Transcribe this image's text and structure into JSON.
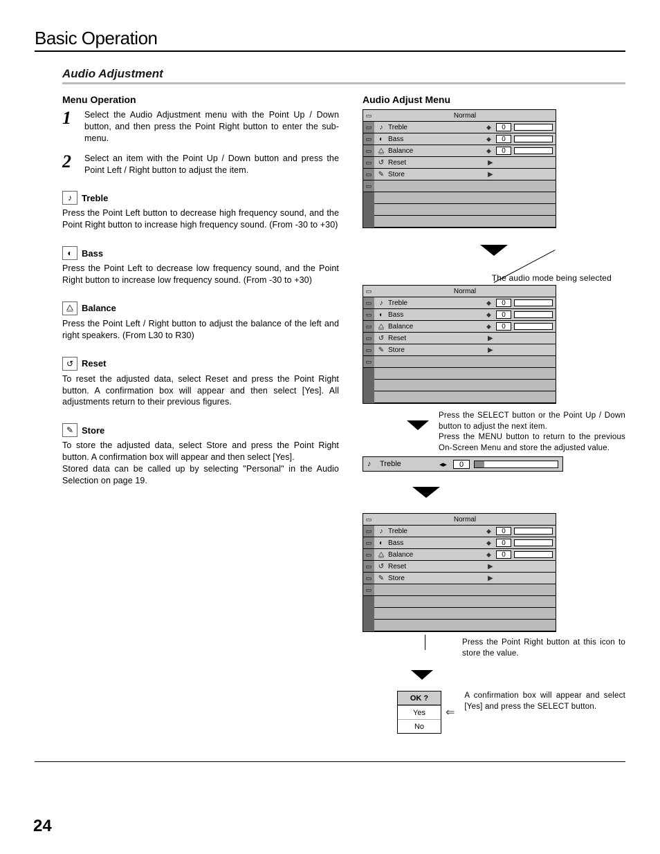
{
  "page": {
    "chapter": "Basic Operation",
    "section": "Audio Adjustment",
    "number": "24"
  },
  "left": {
    "menu_op_h": "Menu Operation",
    "steps": [
      {
        "n": "1",
        "t": "Select the Audio Adjustment menu with the Point Up / Down button, and then press the Point Right button to enter the sub-menu."
      },
      {
        "n": "2",
        "t": "Select an item with the Point Up / Down button and press the Point Left / Right button to adjust the item."
      }
    ],
    "items": [
      {
        "icon": "treble-icon",
        "glyph": "♪",
        "name": "Treble",
        "body": "Press the Point Left button to decrease high frequency sound, and the Point Right button to increase high frequency sound.  (From -30 to +30)"
      },
      {
        "icon": "bass-icon",
        "glyph": "◐",
        "name": "Bass",
        "body": "Press the Point Left to decrease low frequency sound, and the Point Right button to increase low frequency sound.  (From -30 to +30)"
      },
      {
        "icon": "balance-icon",
        "glyph": "⧋",
        "name": "Balance",
        "body": "Press the Point Left / Right button to adjust the balance of the left and right speakers.  (From L30 to R30)"
      },
      {
        "icon": "reset-icon",
        "glyph": "↺",
        "name": "Reset",
        "body": "To reset the adjusted data, select Reset and press the Point Right button.  A confirmation box will appear and then select [Yes].  All adjustments return to their previous figures."
      },
      {
        "icon": "store-icon",
        "glyph": "✎",
        "name": "Store",
        "body": "To store the adjusted data, select Store and press the Point Right button.  A confirmation box will appear and then select [Yes].\nStored data can be called up by selecting \"Personal\" in the Audio Selection on page 19."
      }
    ]
  },
  "right": {
    "heading": "Audio Adjust Menu",
    "mode_label": "Normal",
    "rows": [
      {
        "icon": "♪",
        "label": "Treble",
        "val": "0",
        "type": "val"
      },
      {
        "icon": "◐",
        "label": "Bass",
        "val": "0",
        "type": "val"
      },
      {
        "icon": "⧋",
        "label": "Balance",
        "val": "0",
        "type": "val"
      },
      {
        "icon": "↺",
        "label": "Reset",
        "type": "arrow"
      },
      {
        "icon": "✎",
        "label": "Store",
        "type": "arrow"
      }
    ],
    "annot_mode": "The audio mode being selected",
    "annot_next": "Press the SELECT button or the Point Up / Down button to adjust the next item.\nPress the MENU button to return to the previous On-Screen Menu and store the adjusted value.",
    "slider": {
      "label": "Treble",
      "val": "0"
    },
    "annot_store": "Press the Point Right button at this icon to store the value.",
    "annot_confirm": "A confirmation box will appear and select [Yes] and press the SELECT button.",
    "confirm": {
      "q": "OK ?",
      "yes": "Yes",
      "no": "No"
    }
  }
}
